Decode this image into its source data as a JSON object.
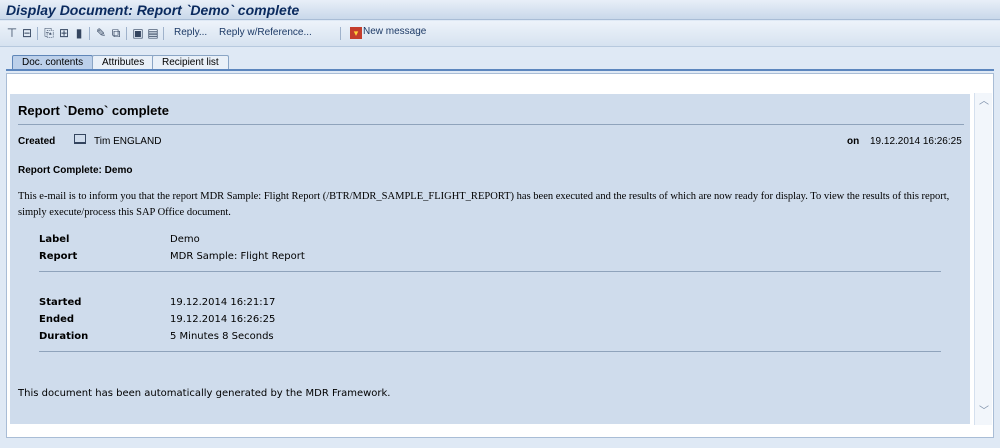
{
  "window": {
    "title": "Display Document: Report `Demo` complete"
  },
  "toolbar": {
    "reply_label": "Reply...",
    "reply_ref_label": "Reply w/Reference...",
    "new_message_label": "New message"
  },
  "tabs": [
    {
      "label": "Doc. contents",
      "active": true
    },
    {
      "label": "Attributes",
      "active": false
    },
    {
      "label": "Recipient list",
      "active": false
    }
  ],
  "document": {
    "title": "Report `Demo` complete",
    "created_label": "Created",
    "created_by": "Tim ENGLAND",
    "on_label": "on",
    "created_on": "19.12.2014   16:26:25",
    "subject": "Report Complete: Demo",
    "body": "This e-mail is to inform you that the report MDR Sample: Flight Report (/BTR/MDR_SAMPLE_FLIGHT_REPORT) has been executed and the results of which are now ready for display. To view the results of this report, simply execute/process this SAP Office document.",
    "details": [
      {
        "label": "Label",
        "value": "Demo"
      },
      {
        "label": "Report",
        "value": "MDR Sample: Flight Report"
      }
    ],
    "timing": [
      {
        "label": "Started",
        "value": "19.12.2014 16:21:17"
      },
      {
        "label": "Ended",
        "value": "19.12.2014 16:26:25"
      },
      {
        "label": "Duration",
        "value": "5 Minutes 8 Seconds"
      }
    ],
    "footer": "This document has been automatically generated by the MDR Framework."
  },
  "icons": [
    "print-icon",
    "print-preview-icon",
    "forward-icon",
    "distribute-icon",
    "delete-icon",
    "edit-icon",
    "copy-icon",
    "save-icon",
    "attachment-icon",
    "new-message-icon",
    "created-doc-icon",
    "scroll-up-icon",
    "scroll-down-icon"
  ]
}
